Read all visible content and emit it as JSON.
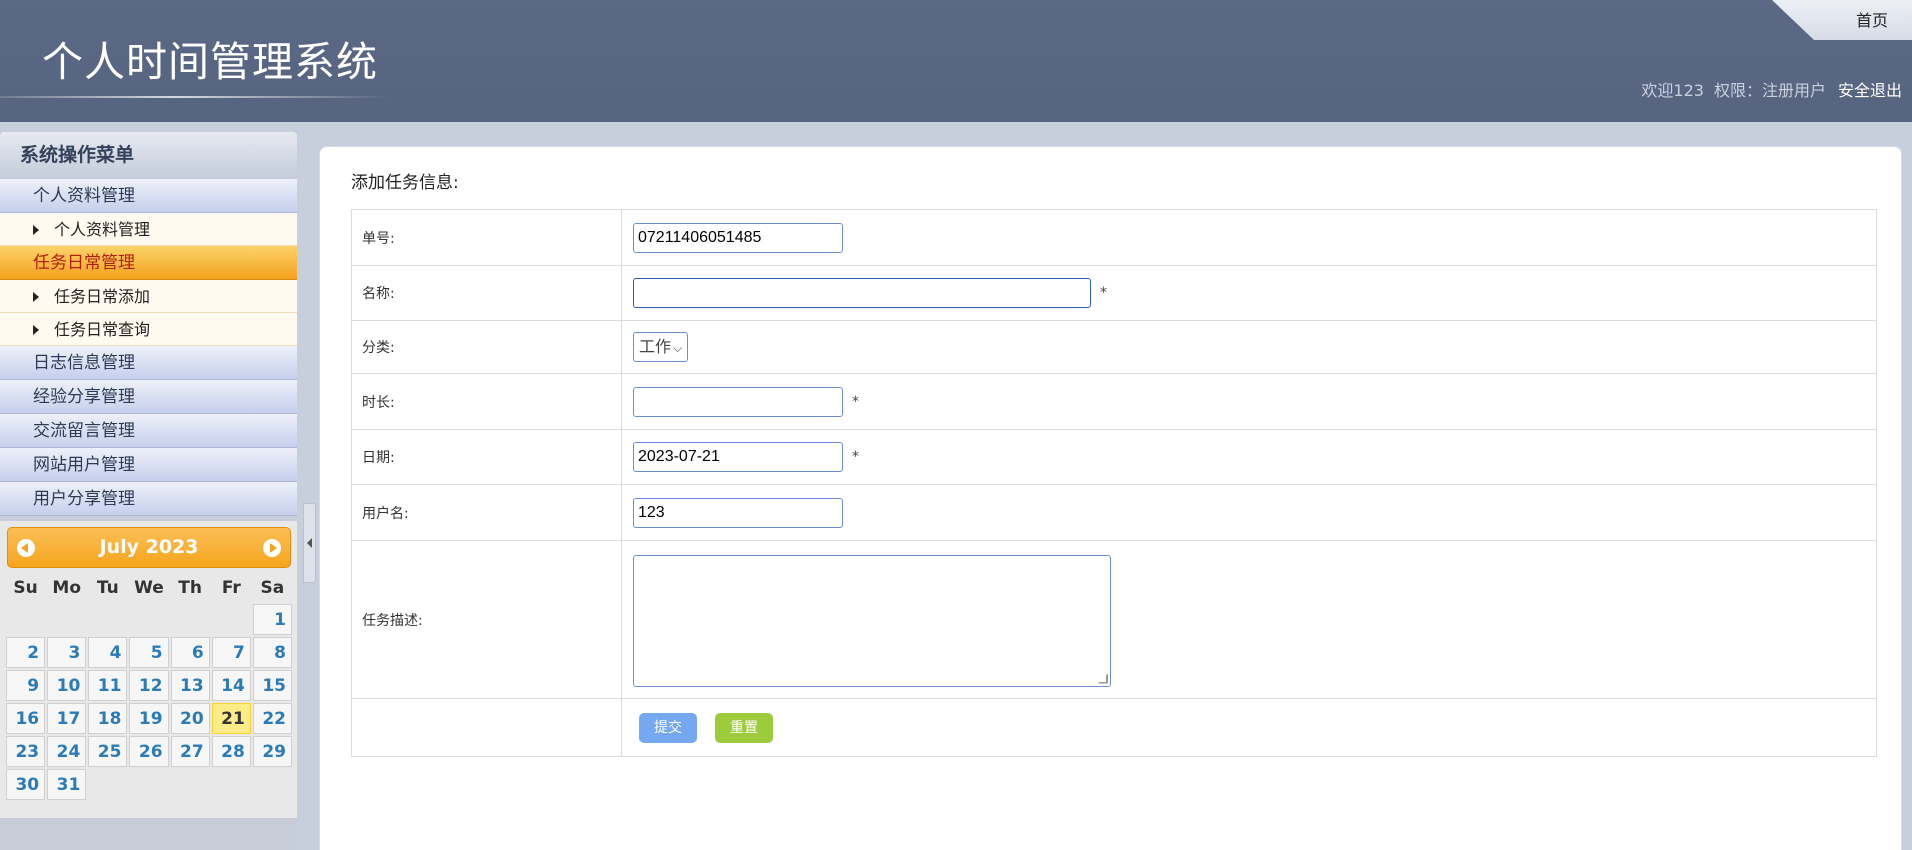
{
  "header": {
    "title": "个人时间管理系统",
    "home": "首页",
    "welcome": "欢迎123",
    "role": "权限：注册用户",
    "logout": "安全退出"
  },
  "sidebar": {
    "title": "系统操作菜单",
    "groups": [
      {
        "label": "个人资料管理"
      },
      {
        "label": "个人资料管理"
      },
      {
        "label": "任务日常管理"
      },
      {
        "label": "任务日常添加"
      },
      {
        "label": "任务日常查询"
      },
      {
        "label": "日志信息管理"
      },
      {
        "label": "经验分享管理"
      },
      {
        "label": "交流留言管理"
      },
      {
        "label": "网站用户管理"
      },
      {
        "label": "用户分享管理"
      }
    ]
  },
  "calendar": {
    "title": "July 2023",
    "weekdays": [
      "Su",
      "Mo",
      "Tu",
      "We",
      "Th",
      "Fr",
      "Sa"
    ],
    "days": [
      "1",
      "2",
      "3",
      "4",
      "5",
      "6",
      "7",
      "8",
      "9",
      "10",
      "11",
      "12",
      "13",
      "14",
      "15",
      "16",
      "17",
      "18",
      "19",
      "20",
      "21",
      "22",
      "23",
      "24",
      "25",
      "26",
      "27",
      "28",
      "29",
      "30",
      "31"
    ],
    "today": "21"
  },
  "form": {
    "title": "添加任务信息:",
    "fields": {
      "order_no": {
        "label": "单号:",
        "value": "07211406051485"
      },
      "name": {
        "label": "名称:",
        "value": "",
        "required": "*"
      },
      "category": {
        "label": "分类:",
        "value": "工作"
      },
      "duration": {
        "label": "时长:",
        "value": "",
        "required": "*"
      },
      "date": {
        "label": "日期:",
        "value": "2023-07-21",
        "required": "*"
      },
      "username": {
        "label": "用户名:",
        "value": "123"
      },
      "description": {
        "label": "任务描述:",
        "value": ""
      }
    },
    "submit": "提交",
    "reset": "重置"
  }
}
